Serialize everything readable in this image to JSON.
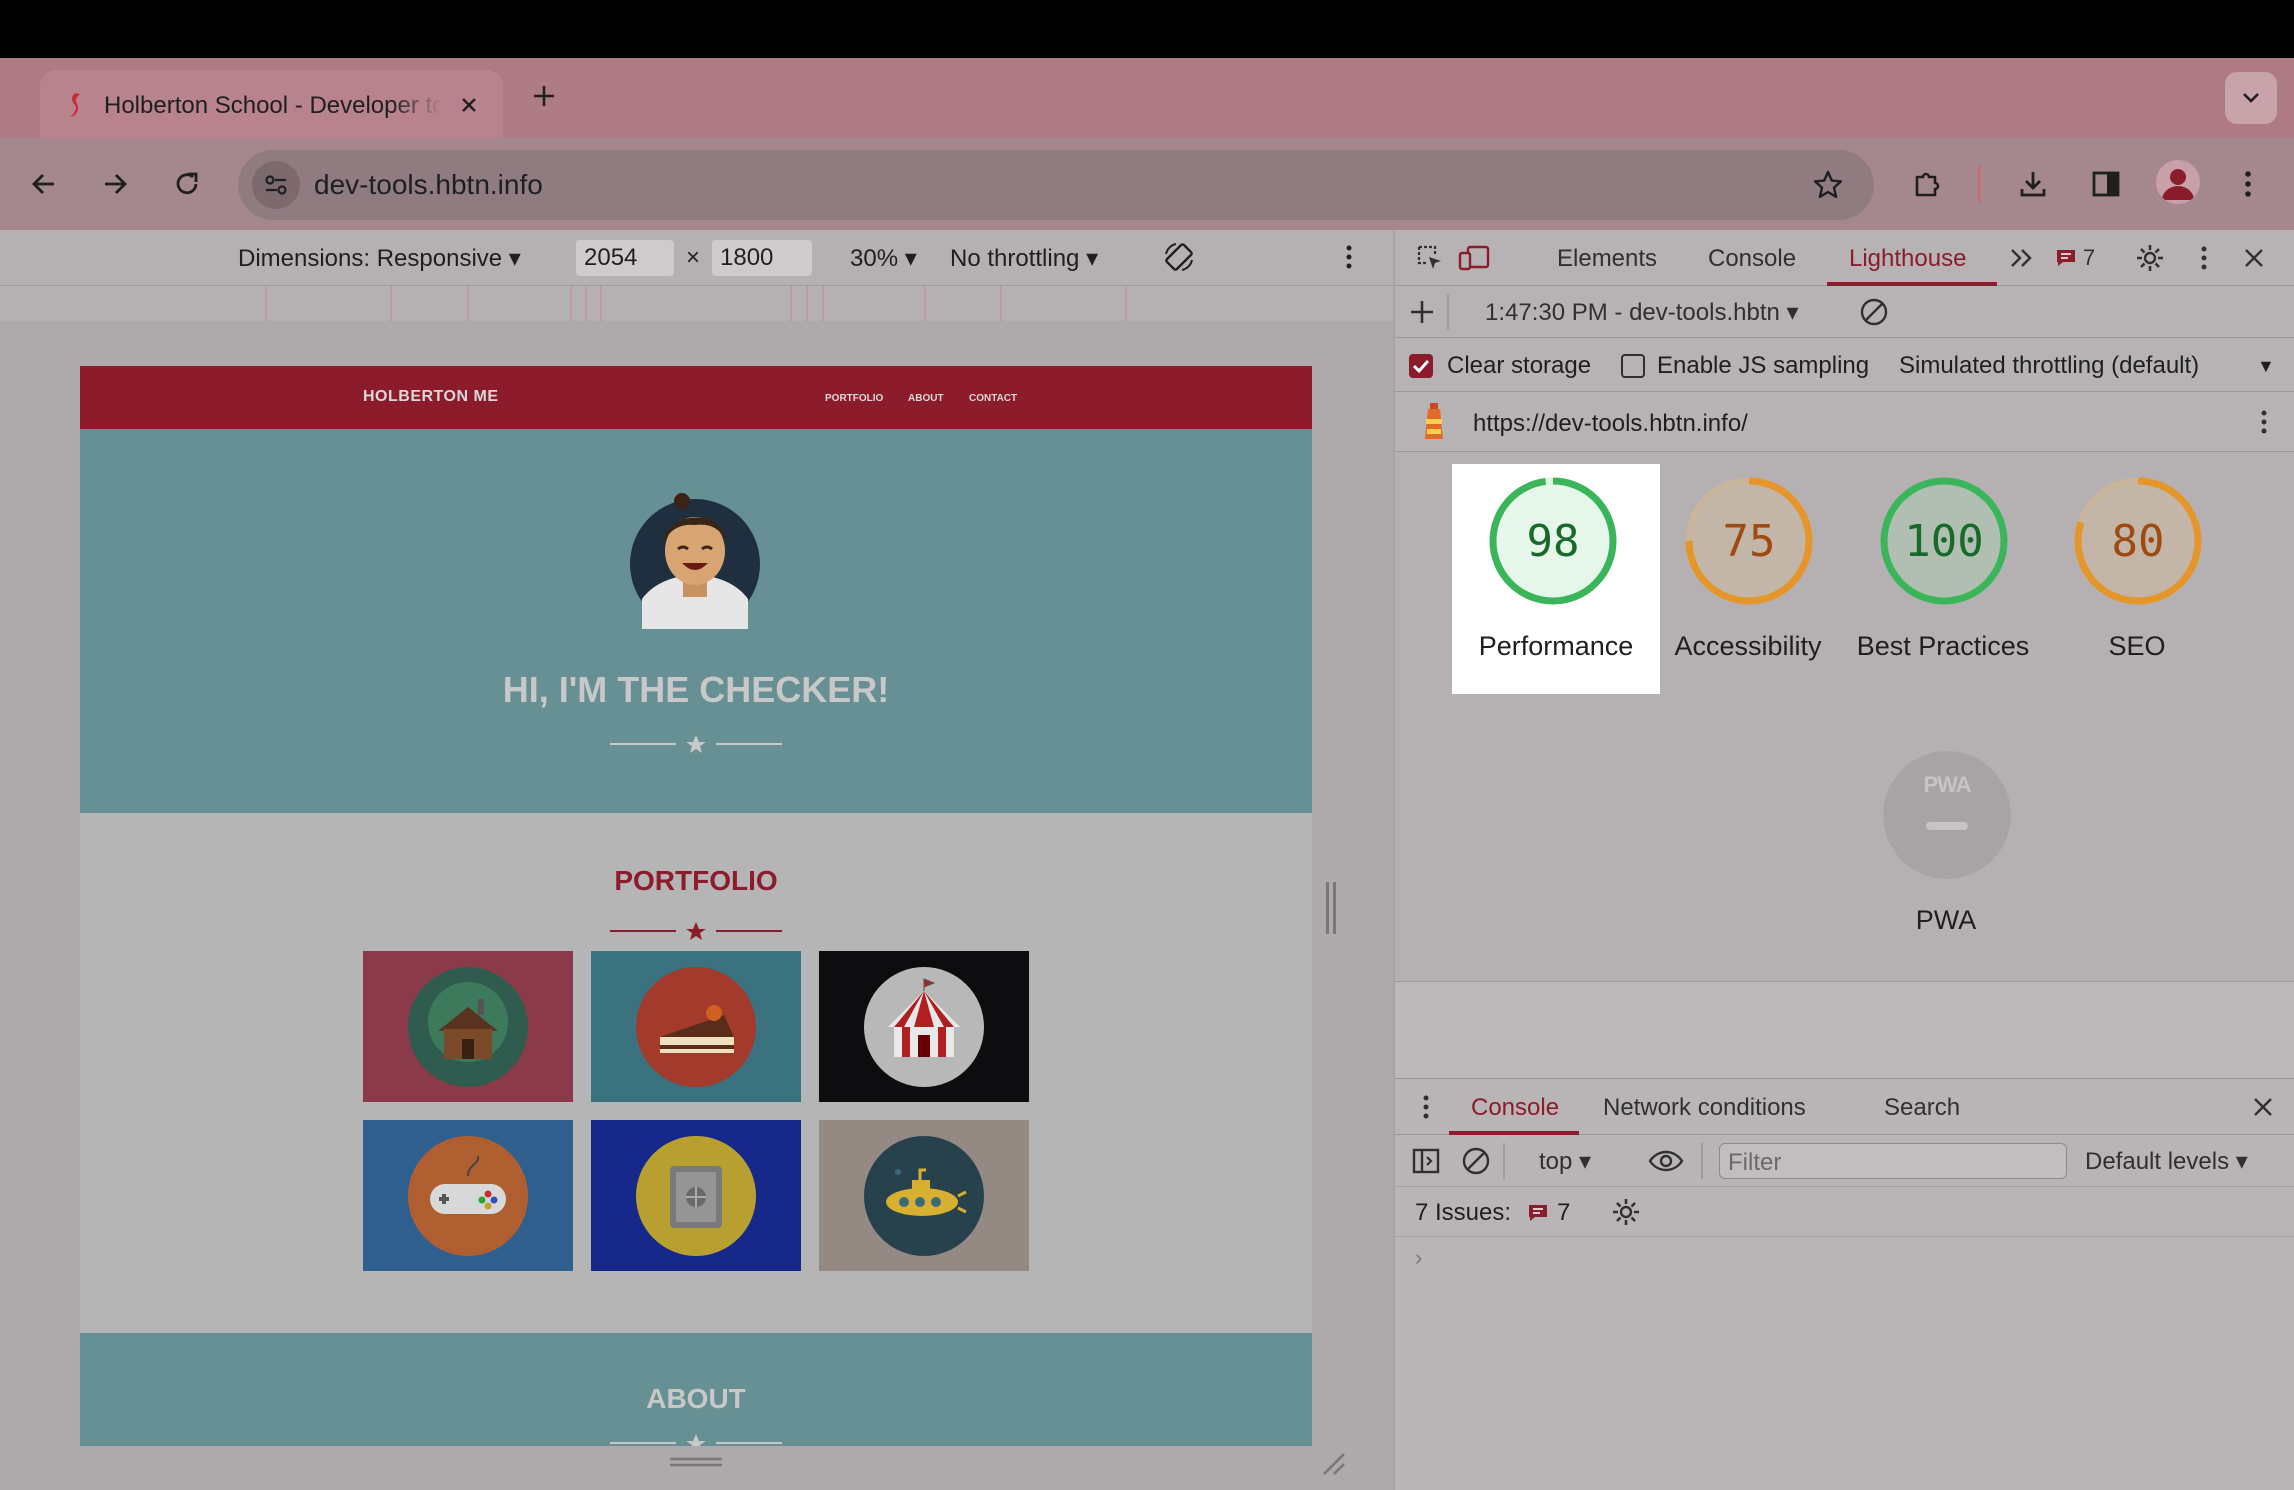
{
  "browser": {
    "tab_title": "Holberton School - Developer tools",
    "url": "dev-tools.hbtn.info"
  },
  "device_toolbar": {
    "dimensions_label": "Dimensions: Responsive",
    "width": "2054",
    "times": "×",
    "height": "1800",
    "zoom": "30%",
    "throttling": "No throttling"
  },
  "site": {
    "brand": "HOLBERTON ME",
    "nav": [
      "PORTFOLIO",
      "ABOUT",
      "CONTACT"
    ],
    "hero_heading": "HI, I'M THE CHECKER!",
    "portfolio_heading": "PORTFOLIO",
    "about_heading": "ABOUT",
    "portfolio_items": [
      {
        "icon": "cabin-icon",
        "bg": "#8a3a48",
        "circle": "#2f5c4e"
      },
      {
        "icon": "cake-icon",
        "bg": "#3a7280",
        "circle": "#a33a2c"
      },
      {
        "icon": "circus-tent-icon",
        "bg": "#0d0c0e",
        "circle": "#b8b8b8"
      },
      {
        "icon": "gamepad-icon",
        "bg": "#2f5f8f",
        "circle": "#b06030"
      },
      {
        "icon": "safe-icon",
        "bg": "#16288a",
        "circle": "#b8a030"
      },
      {
        "icon": "submarine-icon",
        "bg": "#958983",
        "circle": "#27414d"
      }
    ]
  },
  "devtools": {
    "tabs": [
      "Elements",
      "Console",
      "Lighthouse"
    ],
    "active_tab": "Lighthouse",
    "issues_count": "7",
    "report_selector": "1:47:30 PM - dev-tools.hbtn",
    "clear_storage_label": "Clear storage",
    "enable_js_label": "Enable JS sampling",
    "throttling_label": "Simulated throttling (default)",
    "report_url": "https://dev-tools.hbtn.info/",
    "scores": [
      {
        "score": "98",
        "label": "Performance",
        "fraction": 0.98,
        "color": "#3bb55a",
        "text_color": "#176a2a"
      },
      {
        "score": "75",
        "label": "Accessibility",
        "fraction": 0.75,
        "color": "#e5962b",
        "text_color": "#9e4a10"
      },
      {
        "score": "100",
        "label": "Best Practices",
        "fraction": 1.0,
        "color": "#3bb55a",
        "text_color": "#176a2a"
      },
      {
        "score": "80",
        "label": "SEO",
        "fraction": 0.8,
        "color": "#e5962b",
        "text_color": "#9e4a10"
      }
    ],
    "pwa": {
      "badge": "PWA",
      "label": "PWA"
    }
  },
  "drawer": {
    "tabs": [
      "Console",
      "Network conditions",
      "Search"
    ],
    "context": "top",
    "filter_placeholder": "Filter",
    "levels": "Default levels",
    "issues_label": "7 Issues:",
    "issues_count": "7",
    "prompt": "›"
  },
  "colors": {
    "accent": "#8a1c2c",
    "pass": "#3bb55a",
    "average": "#e5962b"
  }
}
